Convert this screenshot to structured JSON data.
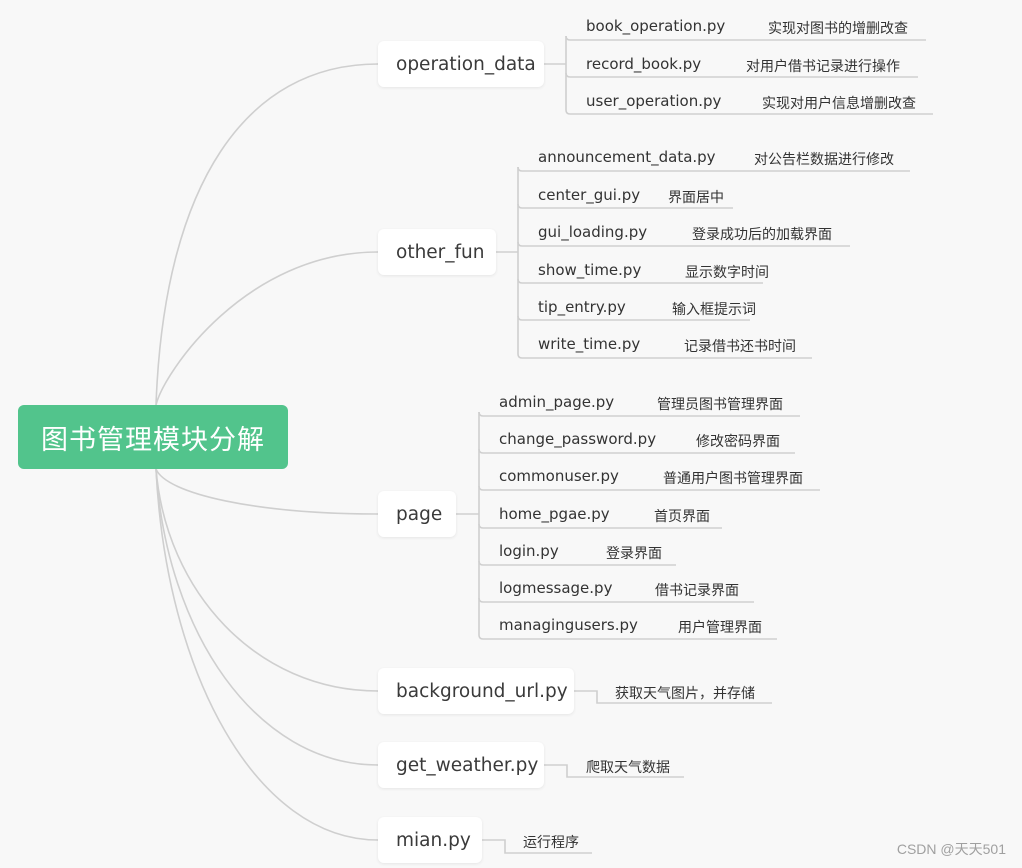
{
  "root": {
    "label": "图书管理模块分解",
    "color": "#52c48c"
  },
  "branches": [
    {
      "label": "operation_data",
      "children": [
        {
          "file": "book_operation.py",
          "desc": "实现对图书的增删改查"
        },
        {
          "file": "record_book.py",
          "desc": "对用户借书记录进行操作"
        },
        {
          "file": "user_operation.py",
          "desc": "实现对用户信息增删改查"
        }
      ]
    },
    {
      "label": "other_fun",
      "children": [
        {
          "file": "announcement_data.py",
          "desc": "对公告栏数据进行修改"
        },
        {
          "file": "center_gui.py",
          "desc": "界面居中"
        },
        {
          "file": "gui_loading.py",
          "desc": "登录成功后的加载界面"
        },
        {
          "file": "show_time.py",
          "desc": "显示数字时间"
        },
        {
          "file": "tip_entry.py",
          "desc": "输入框提示词"
        },
        {
          "file": "write_time.py",
          "desc": "记录借书还书时间"
        }
      ]
    },
    {
      "label": "page",
      "children": [
        {
          "file": "admin_page.py",
          "desc": "管理员图书管理界面"
        },
        {
          "file": "change_password.py",
          "desc": "修改密码界面"
        },
        {
          "file": "commonuser.py",
          "desc": "普通用户图书管理界面"
        },
        {
          "file": "home_pgae.py",
          "desc": "首页界面"
        },
        {
          "file": "login.py",
          "desc": "登录界面"
        },
        {
          "file": "logmessage.py",
          "desc": "借书记录界面"
        },
        {
          "file": "managingusers.py",
          "desc": "用户管理界面"
        }
      ]
    },
    {
      "label": "background_url.py",
      "desc": "获取天气图片，并存储"
    },
    {
      "label": "get_weather.py",
      "desc": "爬取天气数据"
    },
    {
      "label": "mian.py",
      "desc": "运行程序"
    }
  ],
  "watermark": "CSDN @天天501",
  "line_color": "#cfcfcf"
}
